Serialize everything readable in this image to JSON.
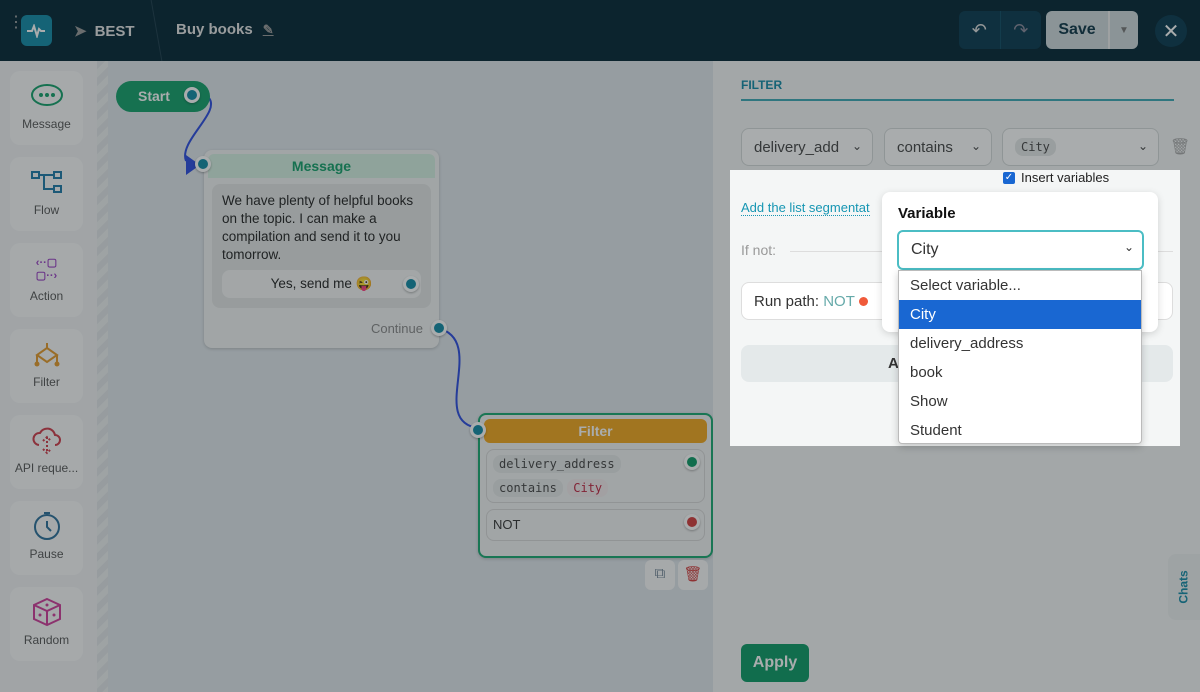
{
  "header": {
    "project": "BEST",
    "title": "Buy books",
    "save_label": "Save"
  },
  "sidebar": {
    "items": [
      {
        "label": "Message"
      },
      {
        "label": "Flow"
      },
      {
        "label": "Action"
      },
      {
        "label": "Filter"
      },
      {
        "label": "API reque..."
      },
      {
        "label": "Pause"
      },
      {
        "label": "Random"
      }
    ]
  },
  "canvas": {
    "start": "Start",
    "message_node": {
      "title": "Message",
      "text": "We have plenty of helpful books on the topic. I can make a compilation and send it to you tomorrow.",
      "button": "Yes, send me 😜",
      "continue": "Continue"
    },
    "filter_node": {
      "title": "Filter",
      "variable": "delivery_address",
      "operator": "contains",
      "value": "City",
      "not_label": "NOT"
    }
  },
  "panel": {
    "heading": "FILTER",
    "variable_select": "delivery_add",
    "operator_select": "contains",
    "value_pill": "City",
    "insert_variables": "Insert variables",
    "add_segment_link": "Add the list segmentat",
    "if_not": "If not:",
    "run_path_label": "Run path:",
    "run_path_value": "NOT",
    "add_button_partial": "A",
    "apply": "Apply",
    "chats": "Chats",
    "variable_popup": {
      "title": "Variable",
      "selected": "City",
      "options": [
        "Select variable...",
        "City",
        "delivery_address",
        "book",
        "Show",
        "Student"
      ]
    }
  },
  "colors": {
    "accent": "#118aa6",
    "header_bg": "#022433",
    "apply": "#0b9a64",
    "filter": "#f2a71c",
    "selected_option": "#1967d2"
  }
}
